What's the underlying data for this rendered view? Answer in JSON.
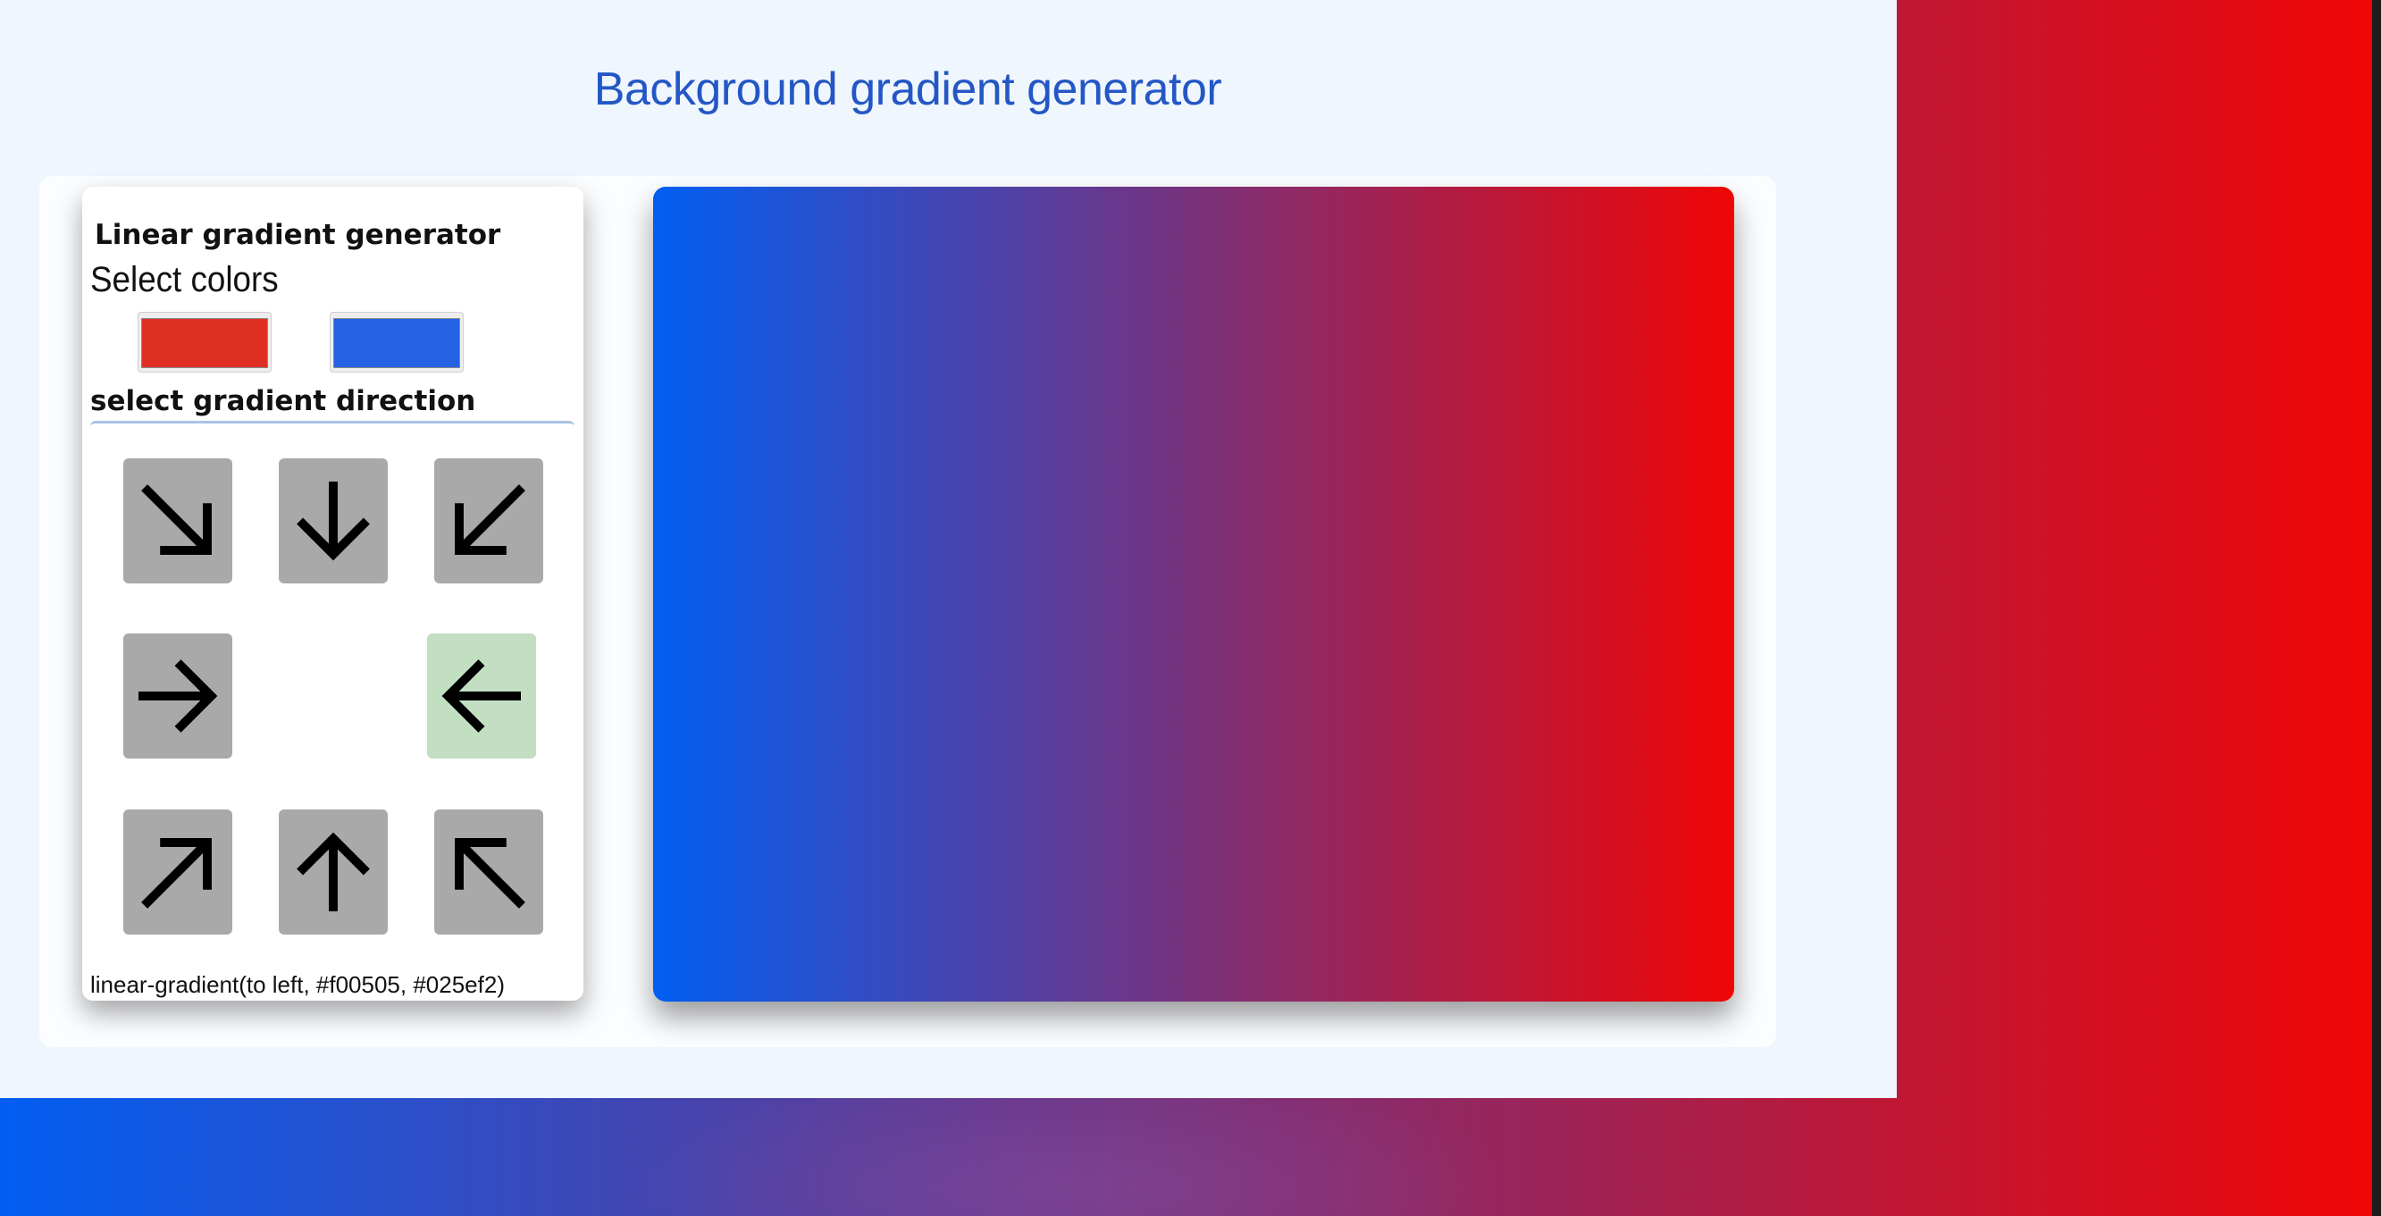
{
  "app": {
    "title": "Background gradient generator"
  },
  "controls": {
    "heading": "Linear gradient generator",
    "select_colors_label": "Select colors",
    "color1": "#f00505",
    "color2": "#025ef2",
    "direction_label": "select gradient direction",
    "selected_direction": "to left",
    "directions": [
      {
        "name": "to bottom right",
        "icon": "arrow-down-right-icon"
      },
      {
        "name": "to bottom",
        "icon": "arrow-down-icon"
      },
      {
        "name": "to bottom left",
        "icon": "arrow-down-left-icon"
      },
      {
        "name": "to right",
        "icon": "arrow-right-icon"
      },
      {
        "name": "to left",
        "icon": "arrow-left-icon"
      },
      {
        "name": "to top right",
        "icon": "arrow-up-right-icon"
      },
      {
        "name": "to top",
        "icon": "arrow-up-icon"
      },
      {
        "name": "to top left",
        "icon": "arrow-up-left-icon"
      }
    ]
  },
  "output": {
    "css_value": "linear-gradient(to left, #f00505, #025ef2)"
  },
  "colors": {
    "title": "#2457c5",
    "app_background": "#eff6fd",
    "button_inactive": "#a9a9a9",
    "button_active": "#c2dfc2"
  }
}
